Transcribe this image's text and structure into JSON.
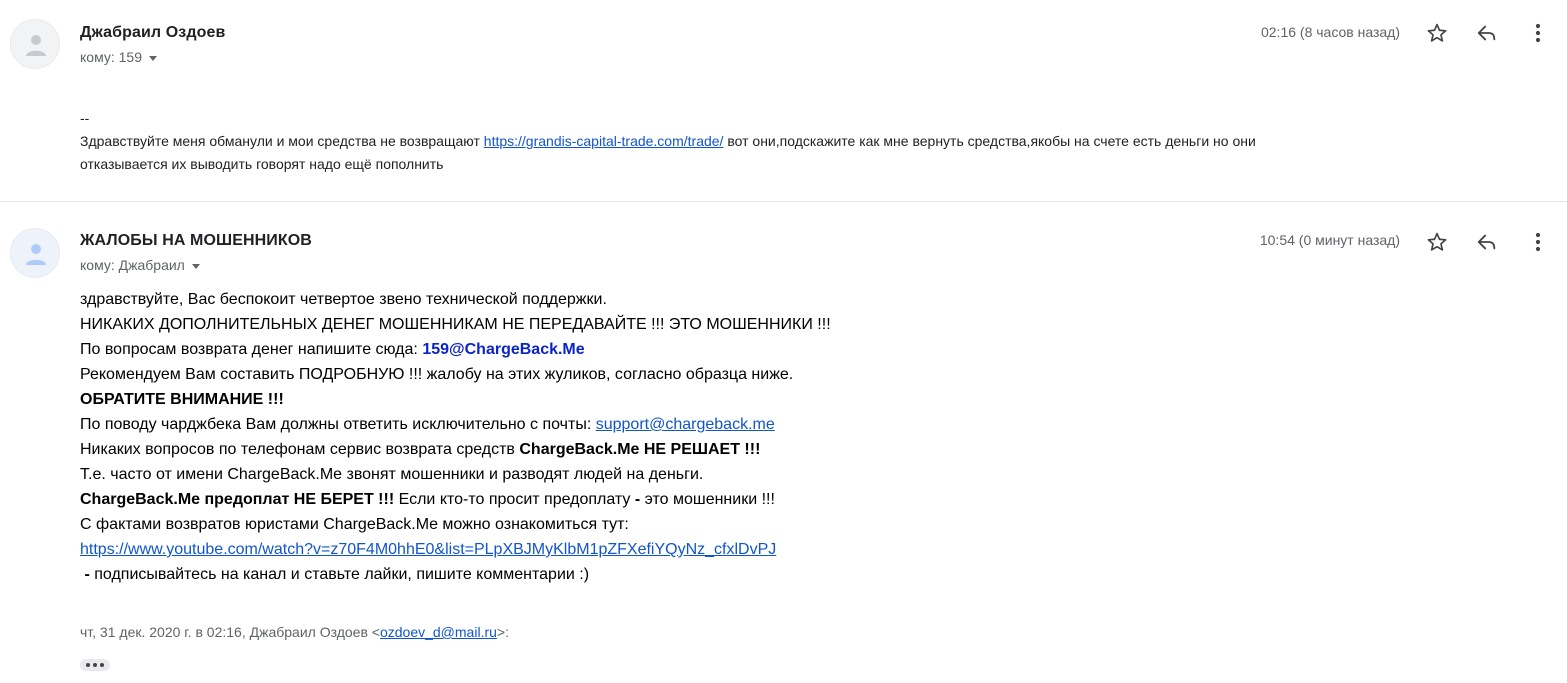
{
  "messages": [
    {
      "sender": "Джабраил Оздоев",
      "to_label": "кому: 159",
      "time": "02:16 (8 часов назад)",
      "body": {
        "dash": "--",
        "text_before_link": "Здравствуйте меня обманули и мои средства не возвращают ",
        "link": "https://grandis-capital-trade.com/trade/",
        "text_after_link_1": " вот они,подскажите как мне вернуть средства,якобы на счете есть деньги но они",
        "text_line_2": "отказывается их выводить говорят надо ещё пополнить"
      }
    },
    {
      "sender": "ЖАЛОБЫ НА МОШЕННИКОВ",
      "to_label": "кому: Джабраил",
      "time": "10:54 (0 минут назад)",
      "body": {
        "l1": "здравствуйте, Вас беспокоит четвертое звено технической поддержки.",
        "l2": "НИКАКИХ ДОПОЛНИТЕЛЬНЫХ ДЕНЕГ МОШЕННИКАМ НЕ ПЕРЕДАВАЙТЕ !!! ЭТО МОШЕННИКИ !!!",
        "l3_text": "По вопросам возврата денег напишите сюда: ",
        "l3_email": "159@ChargeBack.Me",
        "l4": "Рекомендуем Вам составить ПОДРОБНУЮ !!! жалобу на этих жуликов, согласно образца ниже.",
        "l5": "ОБРАТИТЕ ВНИМАНИЕ !!!",
        "l6_text": "По поводу чарджбека Вам должны ответить исключительно с почты: ",
        "l6_link": "support@chargeback.me",
        "l7_text": "Никаких вопросов по телефонам сервис возврата средств ",
        "l7_bold": "ChargeBack.Me НЕ РЕШАЕТ !!!",
        "l8": "Т.е. часто от имени ChargeBack.Me звонят мошенники и разводят людей на деньги.",
        "l9_bold": "ChargeBack.Me предоплат НЕ БЕРЕТ !!!",
        "l9_text": " Если кто-то просит предоплату ",
        "l9_dash": "-",
        "l9_tail": " это мошенники !!!",
        "l10": "С фактами возвратов юристами ChargeBack.Me можно ознакомиться тут:",
        "l11_link": "https://www.youtube.com/watch?v=z70F4M0hhE0&list=PLpXBJMyKlbM1pZFXefiYQyNz_cfxlDvPJ",
        "l12_dash": " -",
        "l12_text": " подписывайтесь на канал и ставьте лайки, пишите комментарии :)"
      },
      "quote_header": {
        "prefix": "чт, 31 дек. 2020 г. в 02:16, Джабраил Оздоев <",
        "email": "ozdoev_d@mail.ru",
        "suffix": ">:"
      }
    }
  ],
  "icons": {
    "avatar": "person-avatar-icon",
    "star": "star-outline-icon",
    "reply": "reply-icon",
    "more": "more-vert-icon",
    "expand": "show-trimmed-content-icon"
  },
  "colors": {
    "link": "#1155cc",
    "email_highlight": "#0b24c9",
    "meta_gray": "#5f6368"
  }
}
